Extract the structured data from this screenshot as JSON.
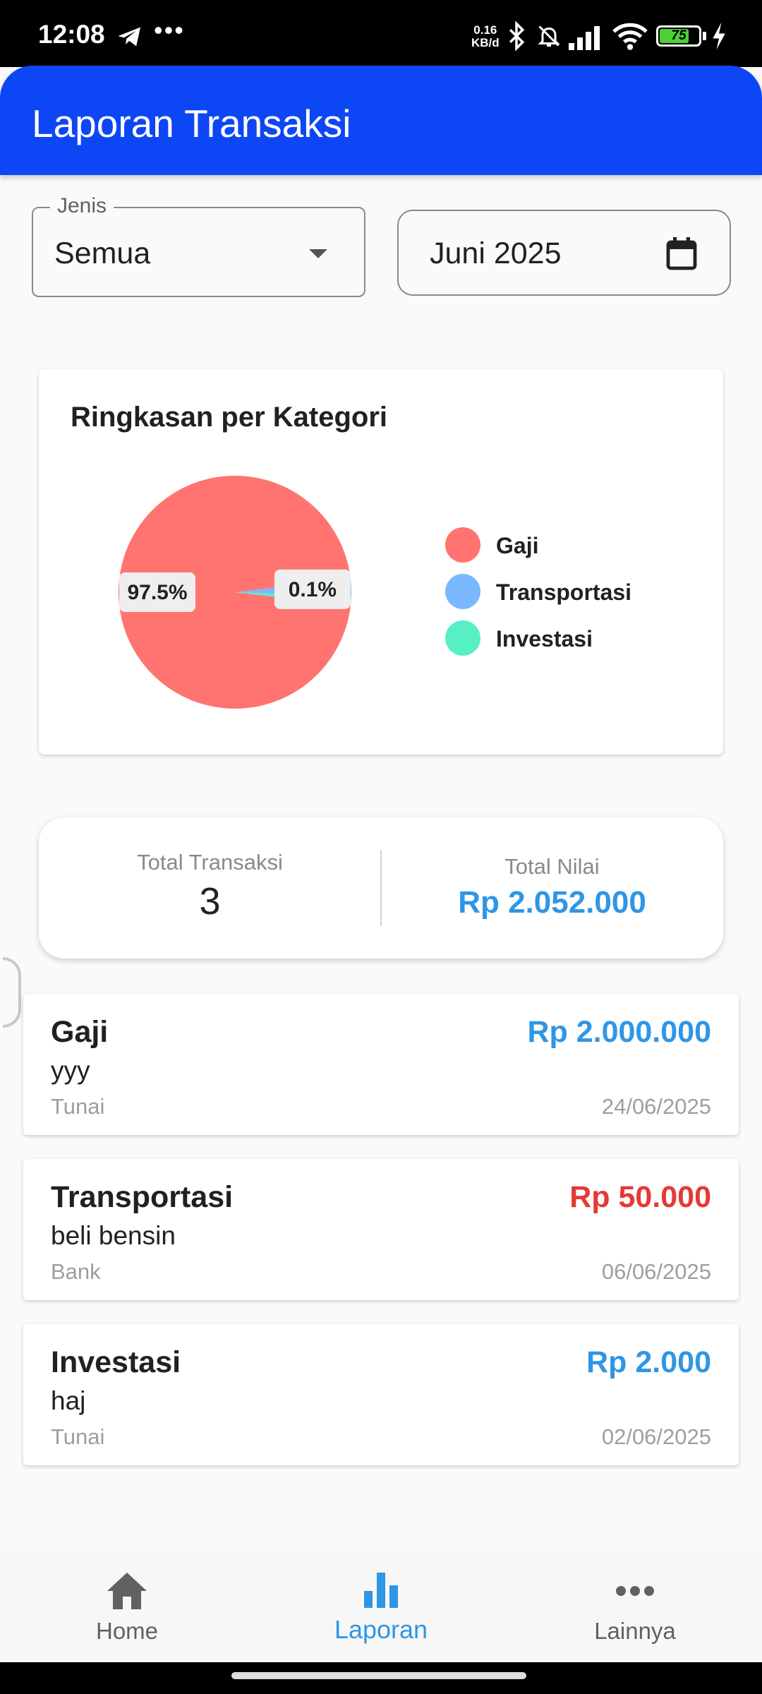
{
  "status_bar": {
    "time": "12:08",
    "speed_top": "0.16",
    "speed_bottom": "KB/d",
    "battery": "75"
  },
  "app_bar": {
    "title": "Laporan Transaksi"
  },
  "filters": {
    "type_label": "Jenis",
    "type_value": "Semua",
    "month_value": "Juni 2025"
  },
  "chart_card": {
    "title": "Ringkasan per Kategori"
  },
  "chart_data": {
    "type": "pie",
    "labels": [
      "Gaji",
      "Transportasi",
      "Investasi"
    ],
    "values": [
      2000000,
      50000,
      2000
    ],
    "slice_labels": [
      "97.5%",
      "0.1%"
    ],
    "colors": [
      "#ff7470",
      "#7ab8ff",
      "#57f0c4"
    ],
    "legend_position": "right"
  },
  "summary": {
    "count_label": "Total Transaksi",
    "count_value": "3",
    "total_label": "Total Nilai",
    "total_value": "Rp 2.052.000"
  },
  "transactions": [
    {
      "category": "Gaji",
      "amount": "Rp 2.000.000",
      "amount_color": "#2e96e6",
      "description": "yyy",
      "source": "Tunai",
      "date": "24/06/2025"
    },
    {
      "category": "Transportasi",
      "amount": "Rp 50.000",
      "amount_color": "#e53935",
      "description": "beli bensin",
      "source": "Bank",
      "date": "06/06/2025"
    },
    {
      "category": "Investasi",
      "amount": "Rp 2.000",
      "amount_color": "#2e96e6",
      "description": "haj",
      "source": "Tunai",
      "date": "02/06/2025"
    }
  ],
  "bottom_nav": {
    "items": [
      {
        "label": "Home",
        "icon": "home-icon"
      },
      {
        "label": "Laporan",
        "icon": "bar-chart-icon",
        "active": true
      },
      {
        "label": "Lainnya",
        "icon": "more-icon"
      }
    ]
  },
  "colors": {
    "primary": "#0d47f5",
    "accent": "#2e96e6",
    "expense": "#e53935"
  }
}
